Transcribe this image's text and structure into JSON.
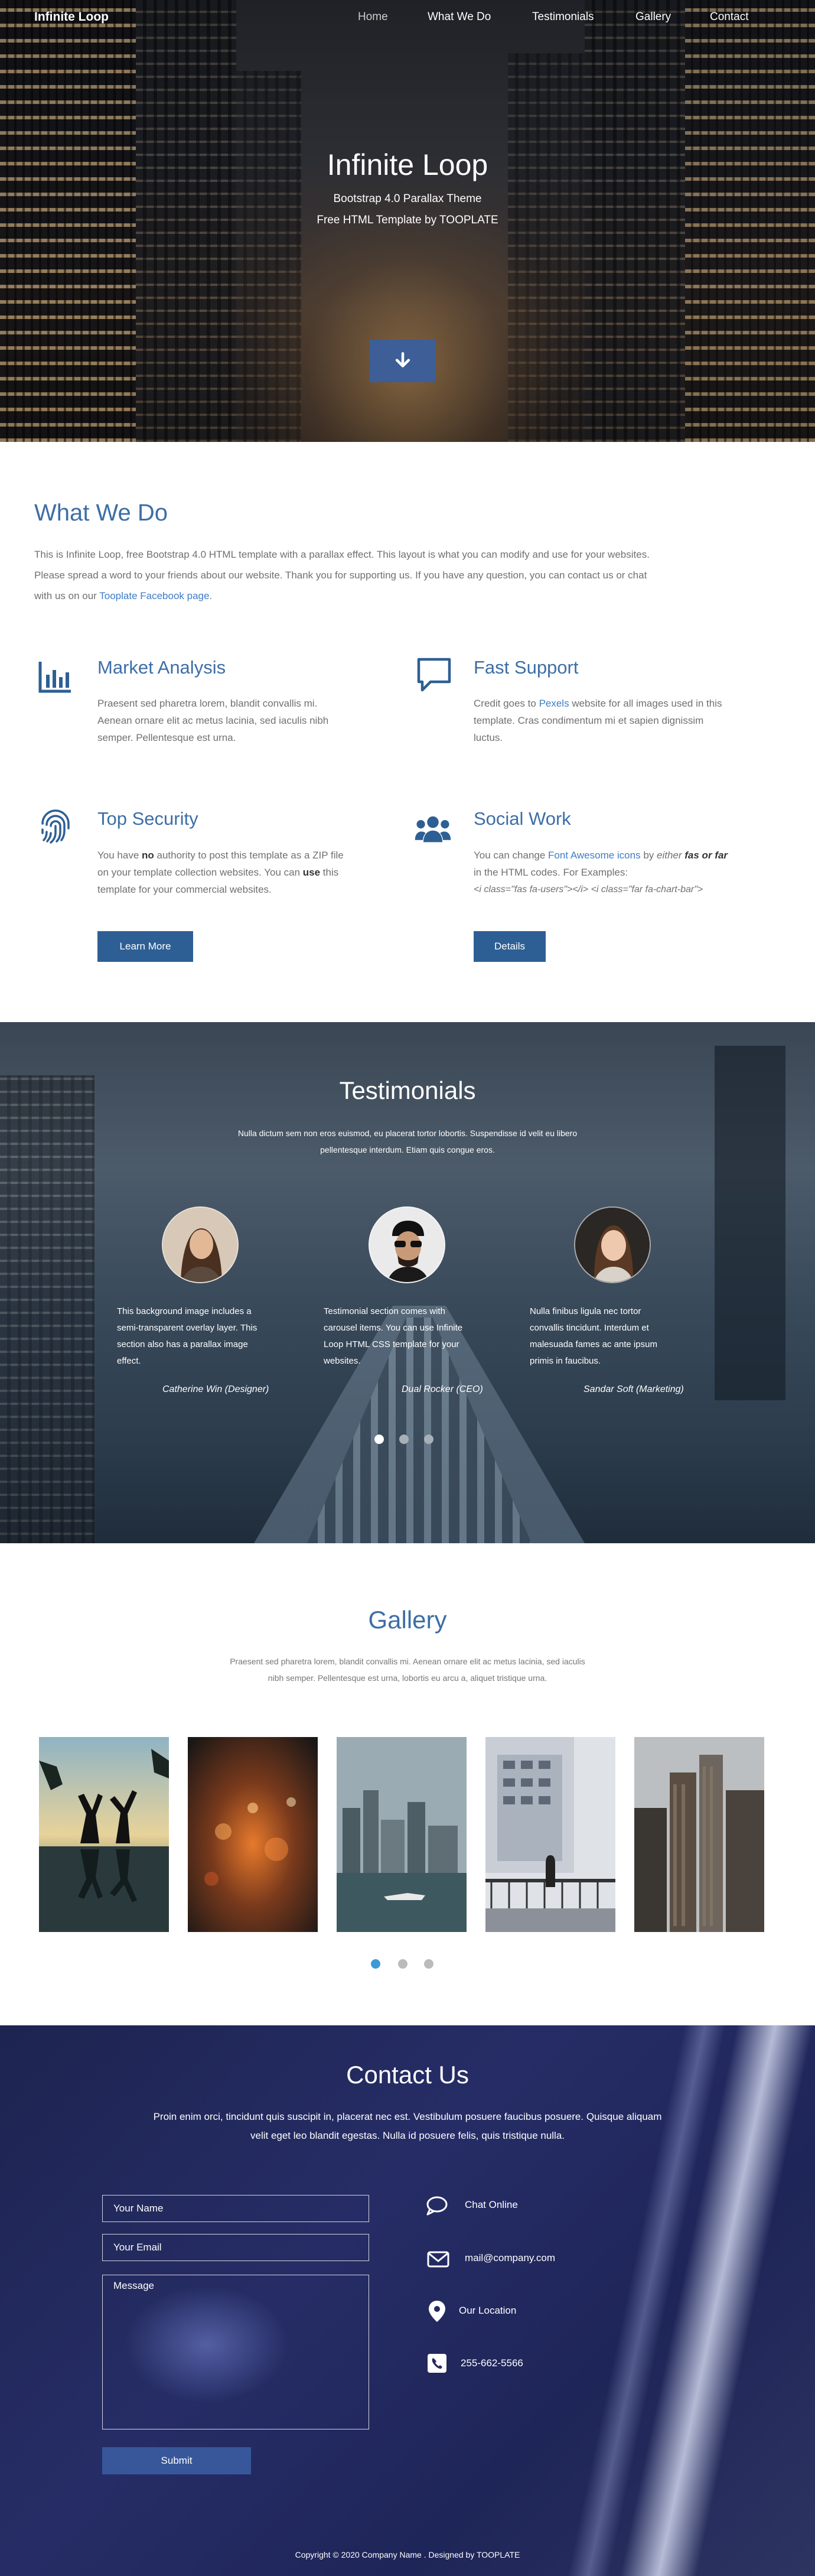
{
  "nav": {
    "brand": "Infinite Loop",
    "links": [
      "Home",
      "What We Do",
      "Testimonials",
      "Gallery",
      "Contact"
    ],
    "active": "Home"
  },
  "hero": {
    "title": "Infinite Loop",
    "subtitle_line1": "Bootstrap 4.0 Parallax Theme",
    "subtitle_line2": "Free HTML Template by TOOPLATE",
    "scroll_icon": "arrow-down-icon"
  },
  "what_we_do": {
    "title": "What We Do",
    "intro_line1": "This is Infinite Loop, free Bootstrap 4.0 HTML template with a parallax effect. This layout is what you can modify and use for your websites.",
    "intro_line2": "Please spread a word to your friends about our website. Thank you for supporting us. If you have any question, you can contact us or chat",
    "intro_line3_pre": "with us on our ",
    "intro_link": "Tooplate Facebook page",
    "intro_line3_post": ".",
    "services": [
      {
        "icon": "chart-bar-icon",
        "title": "Market Analysis",
        "lines": [
          "Praesent sed pharetra lorem, blandit convallis mi.",
          "Aenean ornare elit ac metus lacinia, sed iaculis nibh",
          "semper. Pellentesque est urna."
        ]
      },
      {
        "icon": "comment-icon",
        "title": "Fast Support",
        "line1_pre": "Credit goes to ",
        "line1_link": "Pexels",
        "line1_post": " website for all images used in this",
        "lines": [
          "template. Cras condimentum mi et sapien dignissim",
          "luctus."
        ]
      },
      {
        "icon": "fingerprint-icon",
        "title": "Top Security",
        "line1_pre": "You have ",
        "line1_bold": "no",
        "line1_post": " authority to post this template as a ZIP file",
        "line2_pre": "on your template collection websites. You can ",
        "line2_bold": "use",
        "line2_post": " this",
        "line3": "template for your commercial websites.",
        "button": "Learn More"
      },
      {
        "icon": "users-icon",
        "title": "Social Work",
        "line1_pre": "You can change ",
        "line1_link": "Font Awesome icons",
        "line1_mid": " by ",
        "line1_either": "either",
        "line1_bold": "fas or far",
        "line2": "in the HTML codes. For Examples:",
        "line3": "<i class=\"fas fa-users\"></i> <i class=\"far fa-chart-bar\">",
        "button": "Details"
      }
    ]
  },
  "testimonials": {
    "title": "Testimonials",
    "intro_line1": "Nulla dictum sem non eros euismod, eu placerat tortor lobortis. Suspendisse id velit eu libero",
    "intro_line2": "pellentesque interdum. Etiam quis congue eros.",
    "items": [
      {
        "lines": [
          "This background image includes a",
          "semi-transparent overlay layer. This",
          "section also has a parallax image",
          "effect."
        ],
        "author": "Catherine Win (Designer)"
      },
      {
        "lines": [
          "Testimonial section comes with",
          "carousel items. You can use Infinite",
          "Loop HTML CSS template for your",
          "websites."
        ],
        "author": "Dual Rocker (CEO)"
      },
      {
        "lines": [
          "Nulla finibus ligula nec tortor",
          "convallis tincidunt. Interdum et",
          "malesuada fames ac ante ipsum",
          "primis in faucibus."
        ],
        "author": "Sandar Soft (Marketing)"
      }
    ],
    "active_dot": 0,
    "dot_count": 3
  },
  "gallery": {
    "title": "Gallery",
    "intro_line1": "Praesent sed pharetra lorem, blandit convallis mi. Aenean ornare elit ac metus lacinia, sed iaculis",
    "intro_line2": "nibh semper. Pellentesque est urna, lobortis eu arcu a, aliquet tristique urna.",
    "active_dot": 0,
    "dot_count": 3
  },
  "contact": {
    "title": "Contact Us",
    "intro_line1": "Proin enim orci, tincidunt quis suscipit in, placerat nec est. Vestibulum posuere faucibus posuere. Quisque aliquam",
    "intro_line2": "velit eget leo blandit egestas. Nulla id posuere felis, quis tristique nulla.",
    "name_placeholder": "Your Name",
    "email_placeholder": "Your Email",
    "message_placeholder": "Message",
    "submit": "Submit",
    "info": [
      {
        "icon": "comment-icon",
        "text": "Chat Online"
      },
      {
        "icon": "envelope-icon",
        "text": "mail@company.com"
      },
      {
        "icon": "map-marker-icon",
        "text": "Our Location"
      },
      {
        "icon": "phone-square-icon",
        "text": "255-662-5566"
      }
    ]
  },
  "footer": {
    "text": "Copyright © 2020 Company Name . Designed by TOOPLATE"
  },
  "colors": {
    "accent_blue": "#3d6ea6",
    "button_blue": "#2e5f94",
    "link_blue": "#3d7cc9",
    "dot_active": "#3d9ad6",
    "dot_inactive": "#bbbbbb"
  }
}
